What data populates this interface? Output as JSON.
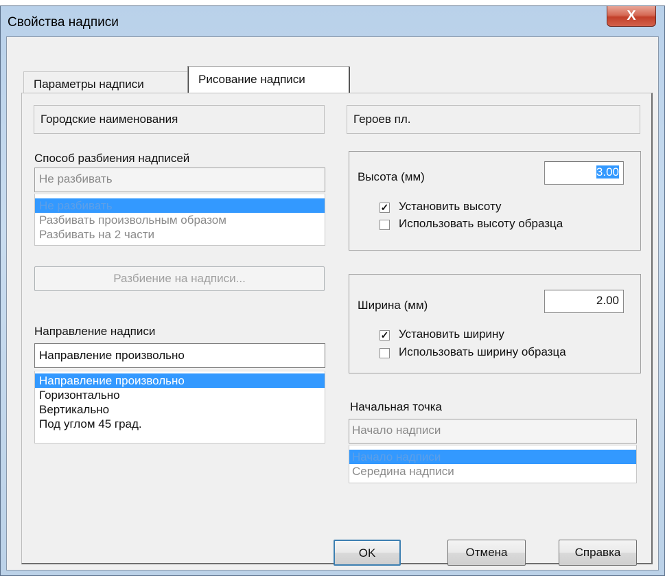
{
  "window": {
    "title": "Свойства надписи",
    "close_glyph": "X"
  },
  "tabs": [
    {
      "label": "Параметры надписи",
      "active": false
    },
    {
      "label": "Рисование надписи",
      "active": true
    }
  ],
  "left": {
    "class_name": "Городские наименования",
    "split_label": "Способ разбиения надписей",
    "split_combo_value": "Не разбивать",
    "split_options": [
      "Не разбивать",
      "Разбивать произвольным образом",
      "Разбивать на 2 части"
    ],
    "split_button": "Разбиение на надписи...",
    "direction_label": "Направление надписи",
    "direction_combo_value": "Направление произвольно",
    "direction_options": [
      "Направление произвольно",
      "Горизонтально",
      "Вертикально",
      "Под углом 45 град."
    ]
  },
  "right": {
    "object_name": "Героев пл.",
    "height": {
      "label": "Высота (мм)",
      "value": "3.00",
      "set_label": "Установить высоту",
      "set_checked": true,
      "sample_label": "Использовать высоту образца",
      "sample_checked": false
    },
    "width": {
      "label": "Ширина (мм)",
      "value": "2.00",
      "set_label": "Установить ширину",
      "set_checked": true,
      "sample_label": "Использовать ширину образца",
      "sample_checked": false
    },
    "start_label": "Начальная точка",
    "start_combo_value": "Начало надписи",
    "start_options": [
      "Начало надписи",
      "Середина надписи"
    ]
  },
  "buttons": {
    "ok": "OK",
    "cancel": "Отмена",
    "help": "Справка"
  },
  "colors": {
    "selection": "#3399ff",
    "title_gradient": "#b9d1ea",
    "close": "#c2402a"
  }
}
